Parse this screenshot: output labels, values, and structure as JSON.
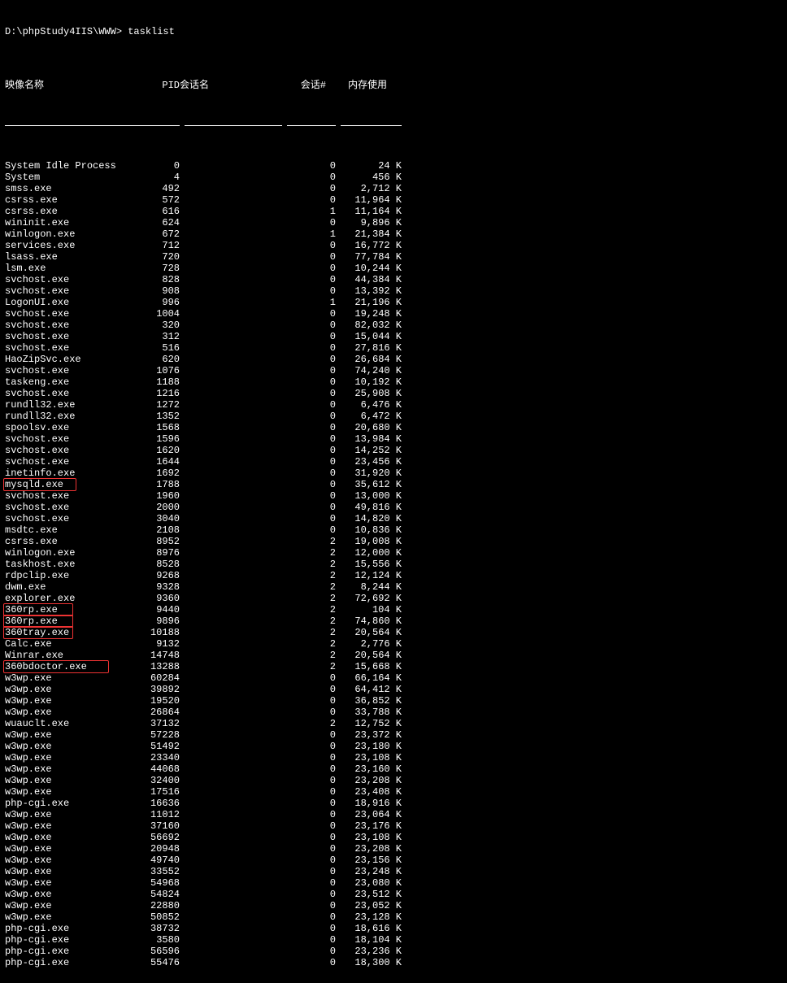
{
  "prompt": "D:\\phpStudy4IIS\\WWW> tasklist",
  "headers": {
    "name": "映像名称",
    "pid": "PID",
    "sess": "会话名",
    "sessnum": "会话#",
    "mem": "内存使用"
  },
  "processes": [
    {
      "name": "System Idle Process",
      "pid": "0",
      "sess": "",
      "sessnum": "0",
      "mem": "24 K",
      "hl": ""
    },
    {
      "name": "System",
      "pid": "4",
      "sess": "",
      "sessnum": "0",
      "mem": "456 K",
      "hl": ""
    },
    {
      "name": "smss.exe",
      "pid": "492",
      "sess": "",
      "sessnum": "0",
      "mem": "2,712 K",
      "hl": ""
    },
    {
      "name": "csrss.exe",
      "pid": "572",
      "sess": "",
      "sessnum": "0",
      "mem": "11,964 K",
      "hl": ""
    },
    {
      "name": "csrss.exe",
      "pid": "616",
      "sess": "",
      "sessnum": "1",
      "mem": "11,164 K",
      "hl": ""
    },
    {
      "name": "wininit.exe",
      "pid": "624",
      "sess": "",
      "sessnum": "0",
      "mem": "9,896 K",
      "hl": ""
    },
    {
      "name": "winlogon.exe",
      "pid": "672",
      "sess": "",
      "sessnum": "1",
      "mem": "21,384 K",
      "hl": ""
    },
    {
      "name": "services.exe",
      "pid": "712",
      "sess": "",
      "sessnum": "0",
      "mem": "16,772 K",
      "hl": ""
    },
    {
      "name": "lsass.exe",
      "pid": "720",
      "sess": "",
      "sessnum": "0",
      "mem": "77,784 K",
      "hl": ""
    },
    {
      "name": "lsm.exe",
      "pid": "728",
      "sess": "",
      "sessnum": "0",
      "mem": "10,244 K",
      "hl": ""
    },
    {
      "name": "svchost.exe",
      "pid": "828",
      "sess": "",
      "sessnum": "0",
      "mem": "44,384 K",
      "hl": ""
    },
    {
      "name": "svchost.exe",
      "pid": "908",
      "sess": "",
      "sessnum": "0",
      "mem": "13,392 K",
      "hl": ""
    },
    {
      "name": "LogonUI.exe",
      "pid": "996",
      "sess": "",
      "sessnum": "1",
      "mem": "21,196 K",
      "hl": ""
    },
    {
      "name": "svchost.exe",
      "pid": "1004",
      "sess": "",
      "sessnum": "0",
      "mem": "19,248 K",
      "hl": ""
    },
    {
      "name": "svchost.exe",
      "pid": "320",
      "sess": "",
      "sessnum": "0",
      "mem": "82,032 K",
      "hl": ""
    },
    {
      "name": "svchost.exe",
      "pid": "312",
      "sess": "",
      "sessnum": "0",
      "mem": "15,044 K",
      "hl": ""
    },
    {
      "name": "svchost.exe",
      "pid": "516",
      "sess": "",
      "sessnum": "0",
      "mem": "27,816 K",
      "hl": ""
    },
    {
      "name": "HaoZipSvc.exe",
      "pid": "620",
      "sess": "",
      "sessnum": "0",
      "mem": "26,684 K",
      "hl": ""
    },
    {
      "name": "svchost.exe",
      "pid": "1076",
      "sess": "",
      "sessnum": "0",
      "mem": "74,240 K",
      "hl": ""
    },
    {
      "name": "taskeng.exe",
      "pid": "1188",
      "sess": "",
      "sessnum": "0",
      "mem": "10,192 K",
      "hl": ""
    },
    {
      "name": "svchost.exe",
      "pid": "1216",
      "sess": "",
      "sessnum": "0",
      "mem": "25,908 K",
      "hl": ""
    },
    {
      "name": "rundll32.exe",
      "pid": "1272",
      "sess": "",
      "sessnum": "0",
      "mem": "6,476 K",
      "hl": ""
    },
    {
      "name": "rundll32.exe",
      "pid": "1352",
      "sess": "",
      "sessnum": "0",
      "mem": "6,472 K",
      "hl": ""
    },
    {
      "name": "spoolsv.exe",
      "pid": "1568",
      "sess": "",
      "sessnum": "0",
      "mem": "20,680 K",
      "hl": ""
    },
    {
      "name": "svchost.exe",
      "pid": "1596",
      "sess": "",
      "sessnum": "0",
      "mem": "13,984 K",
      "hl": ""
    },
    {
      "name": "svchost.exe",
      "pid": "1620",
      "sess": "",
      "sessnum": "0",
      "mem": "14,252 K",
      "hl": ""
    },
    {
      "name": "svchost.exe",
      "pid": "1644",
      "sess": "",
      "sessnum": "0",
      "mem": "23,456 K",
      "hl": ""
    },
    {
      "name": "inetinfo.exe",
      "pid": "1692",
      "sess": "",
      "sessnum": "0",
      "mem": "31,920 K",
      "hl": ""
    },
    {
      "name": "mysqld.exe",
      "pid": "1788",
      "sess": "",
      "sessnum": "0",
      "mem": "35,612 K",
      "hl": "hl-w1"
    },
    {
      "name": "svchost.exe",
      "pid": "1960",
      "sess": "",
      "sessnum": "0",
      "mem": "13,000 K",
      "hl": ""
    },
    {
      "name": "svchost.exe",
      "pid": "2000",
      "sess": "",
      "sessnum": "0",
      "mem": "49,816 K",
      "hl": ""
    },
    {
      "name": "svchost.exe",
      "pid": "3040",
      "sess": "",
      "sessnum": "0",
      "mem": "14,820 K",
      "hl": ""
    },
    {
      "name": "msdtc.exe",
      "pid": "2108",
      "sess": "",
      "sessnum": "0",
      "mem": "10,836 K",
      "hl": ""
    },
    {
      "name": "csrss.exe",
      "pid": "8952",
      "sess": "",
      "sessnum": "2",
      "mem": "19,008 K",
      "hl": ""
    },
    {
      "name": "winlogon.exe",
      "pid": "8976",
      "sess": "",
      "sessnum": "2",
      "mem": "12,000 K",
      "hl": ""
    },
    {
      "name": "taskhost.exe",
      "pid": "8528",
      "sess": "",
      "sessnum": "2",
      "mem": "15,556 K",
      "hl": ""
    },
    {
      "name": "rdpclip.exe",
      "pid": "9268",
      "sess": "",
      "sessnum": "2",
      "mem": "12,124 K",
      "hl": ""
    },
    {
      "name": "dwm.exe",
      "pid": "9328",
      "sess": "",
      "sessnum": "2",
      "mem": "8,244 K",
      "hl": ""
    },
    {
      "name": "explorer.exe",
      "pid": "9360",
      "sess": "",
      "sessnum": "2",
      "mem": "72,692 K",
      "hl": ""
    },
    {
      "name": "360rp.exe",
      "pid": "9440",
      "sess": "",
      "sessnum": "2",
      "mem": "104 K",
      "hl": "hl-w2"
    },
    {
      "name": "360rp.exe",
      "pid": "9896",
      "sess": "",
      "sessnum": "2",
      "mem": "74,860 K",
      "hl": "hl-w2"
    },
    {
      "name": "360tray.exe",
      "pid": "10188",
      "sess": "",
      "sessnum": "2",
      "mem": "20,564 K",
      "hl": "hl-w2"
    },
    {
      "name": "Calc.exe",
      "pid": "9132",
      "sess": "",
      "sessnum": "2",
      "mem": "2,776 K",
      "hl": ""
    },
    {
      "name": "Winrar.exe",
      "pid": "14748",
      "sess": "",
      "sessnum": "2",
      "mem": "20,564 K",
      "hl": ""
    },
    {
      "name": "360bdoctor.exe",
      "pid": "13288",
      "sess": "",
      "sessnum": "2",
      "mem": "15,668 K",
      "hl": "hl-w3"
    },
    {
      "name": "w3wp.exe",
      "pid": "60284",
      "sess": "",
      "sessnum": "0",
      "mem": "66,164 K",
      "hl": ""
    },
    {
      "name": "w3wp.exe",
      "pid": "39892",
      "sess": "",
      "sessnum": "0",
      "mem": "64,412 K",
      "hl": ""
    },
    {
      "name": "w3wp.exe",
      "pid": "19520",
      "sess": "",
      "sessnum": "0",
      "mem": "36,852 K",
      "hl": ""
    },
    {
      "name": "w3wp.exe",
      "pid": "26864",
      "sess": "",
      "sessnum": "0",
      "mem": "33,788 K",
      "hl": ""
    },
    {
      "name": "wuauclt.exe",
      "pid": "37132",
      "sess": "",
      "sessnum": "2",
      "mem": "12,752 K",
      "hl": ""
    },
    {
      "name": "w3wp.exe",
      "pid": "57228",
      "sess": "",
      "sessnum": "0",
      "mem": "23,372 K",
      "hl": ""
    },
    {
      "name": "w3wp.exe",
      "pid": "51492",
      "sess": "",
      "sessnum": "0",
      "mem": "23,180 K",
      "hl": ""
    },
    {
      "name": "w3wp.exe",
      "pid": "23340",
      "sess": "",
      "sessnum": "0",
      "mem": "23,108 K",
      "hl": ""
    },
    {
      "name": "w3wp.exe",
      "pid": "44068",
      "sess": "",
      "sessnum": "0",
      "mem": "23,160 K",
      "hl": ""
    },
    {
      "name": "w3wp.exe",
      "pid": "32400",
      "sess": "",
      "sessnum": "0",
      "mem": "23,208 K",
      "hl": ""
    },
    {
      "name": "w3wp.exe",
      "pid": "17516",
      "sess": "",
      "sessnum": "0",
      "mem": "23,408 K",
      "hl": ""
    },
    {
      "name": "php-cgi.exe",
      "pid": "16636",
      "sess": "",
      "sessnum": "0",
      "mem": "18,916 K",
      "hl": ""
    },
    {
      "name": "w3wp.exe",
      "pid": "11012",
      "sess": "",
      "sessnum": "0",
      "mem": "23,064 K",
      "hl": ""
    },
    {
      "name": "w3wp.exe",
      "pid": "37160",
      "sess": "",
      "sessnum": "0",
      "mem": "23,176 K",
      "hl": ""
    },
    {
      "name": "w3wp.exe",
      "pid": "56692",
      "sess": "",
      "sessnum": "0",
      "mem": "23,108 K",
      "hl": ""
    },
    {
      "name": "w3wp.exe",
      "pid": "20948",
      "sess": "",
      "sessnum": "0",
      "mem": "23,208 K",
      "hl": ""
    },
    {
      "name": "w3wp.exe",
      "pid": "49740",
      "sess": "",
      "sessnum": "0",
      "mem": "23,156 K",
      "hl": ""
    },
    {
      "name": "w3wp.exe",
      "pid": "33552",
      "sess": "",
      "sessnum": "0",
      "mem": "23,248 K",
      "hl": ""
    },
    {
      "name": "w3wp.exe",
      "pid": "54968",
      "sess": "",
      "sessnum": "0",
      "mem": "23,080 K",
      "hl": ""
    },
    {
      "name": "w3wp.exe",
      "pid": "54824",
      "sess": "",
      "sessnum": "0",
      "mem": "23,512 K",
      "hl": ""
    },
    {
      "name": "w3wp.exe",
      "pid": "22880",
      "sess": "",
      "sessnum": "0",
      "mem": "23,052 K",
      "hl": ""
    },
    {
      "name": "w3wp.exe",
      "pid": "50852",
      "sess": "",
      "sessnum": "0",
      "mem": "23,128 K",
      "hl": ""
    },
    {
      "name": "php-cgi.exe",
      "pid": "38732",
      "sess": "",
      "sessnum": "0",
      "mem": "18,616 K",
      "hl": ""
    },
    {
      "name": "php-cgi.exe",
      "pid": "3580",
      "sess": "",
      "sessnum": "0",
      "mem": "18,104 K",
      "hl": ""
    },
    {
      "name": "php-cgi.exe",
      "pid": "56596",
      "sess": "",
      "sessnum": "0",
      "mem": "23,236 K",
      "hl": ""
    },
    {
      "name": "php-cgi.exe",
      "pid": "55476",
      "sess": "",
      "sessnum": "0",
      "mem": "18,300 K",
      "hl": ""
    }
  ]
}
